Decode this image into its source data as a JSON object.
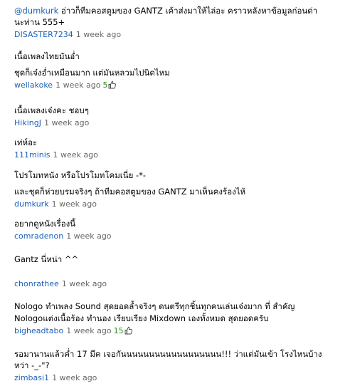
{
  "comments": [
    {
      "mention": "@dumkurk",
      "text": " อ่าวก็ทีมคอสตูมของ GANTZ เค้าส่งมาให้ไล่อะ คราวหลังหาข้อมูลก่อนด่านะท่าน 555+",
      "author": "DISASTER7234",
      "time": "1 week ago"
    },
    {
      "line1": "เนื้อเพลงไทยมันอ่ำ",
      "line2": "ชุดก็เจ๋งอ่ำเหมือนมาก แต่มันหลวมไปนิดไหม",
      "author": "wellakoke",
      "time": "1 week ago",
      "likes": "5"
    },
    {
      "line1": "เนื้อเพลงเจ๋งคะ ชอบๆ",
      "author": "HikingJ",
      "time": "1 week ago"
    },
    {
      "line1": "เท่ห์อะ",
      "author": "111minis",
      "time": "1 week ago"
    },
    {
      "line1": "โปรโมทหนัง หรือโปรโมทโคมเนี่ย -*-",
      "line2": "และชุดก็ห่วยบรมจริงๆ ถ้าทีมคอสตูมของ GANTZ มาเห็นคงร้องไห้",
      "author": "dumkurk",
      "time": "1 week ago"
    },
    {
      "line1": "อยากดูหนังเรื่องนี้",
      "author": "comradenon",
      "time": "1 week ago"
    },
    {
      "line1": "Gantz นี่หน่า ^^",
      "author": "chonrathee",
      "time": "1 week ago"
    },
    {
      "line1": "Nologo ทำเพลง Sound สุดยอดล้ำจริงๆ ดนตรีทุกชิ้นทุกคนเล่นเจ๋งมาก ที่ สำคัญ",
      "line2": "Nologoแต่งเนื้อร้อง ทำนอง เรียบเรียง Mixdown เองทั้งหมด สุดยอดครับ",
      "author": "bigheadtabo",
      "time": "1 week ago",
      "likes": "15"
    },
    {
      "line1": "รอมานานแล้วค่ำ 17 มีค เจอกันนนนนนนนนนนนนนนนนน!!! ว่าแต่มันเข้า โรงไหนบ้างหว่า -_-\"?",
      "author": "zimbasi1",
      "time": "1 week ago"
    }
  ],
  "colors": {
    "link": "#1c62b9",
    "likes": "#2e8b1e",
    "meta": "#666666"
  },
  "icons": {
    "like": "thumbs-up-icon"
  }
}
